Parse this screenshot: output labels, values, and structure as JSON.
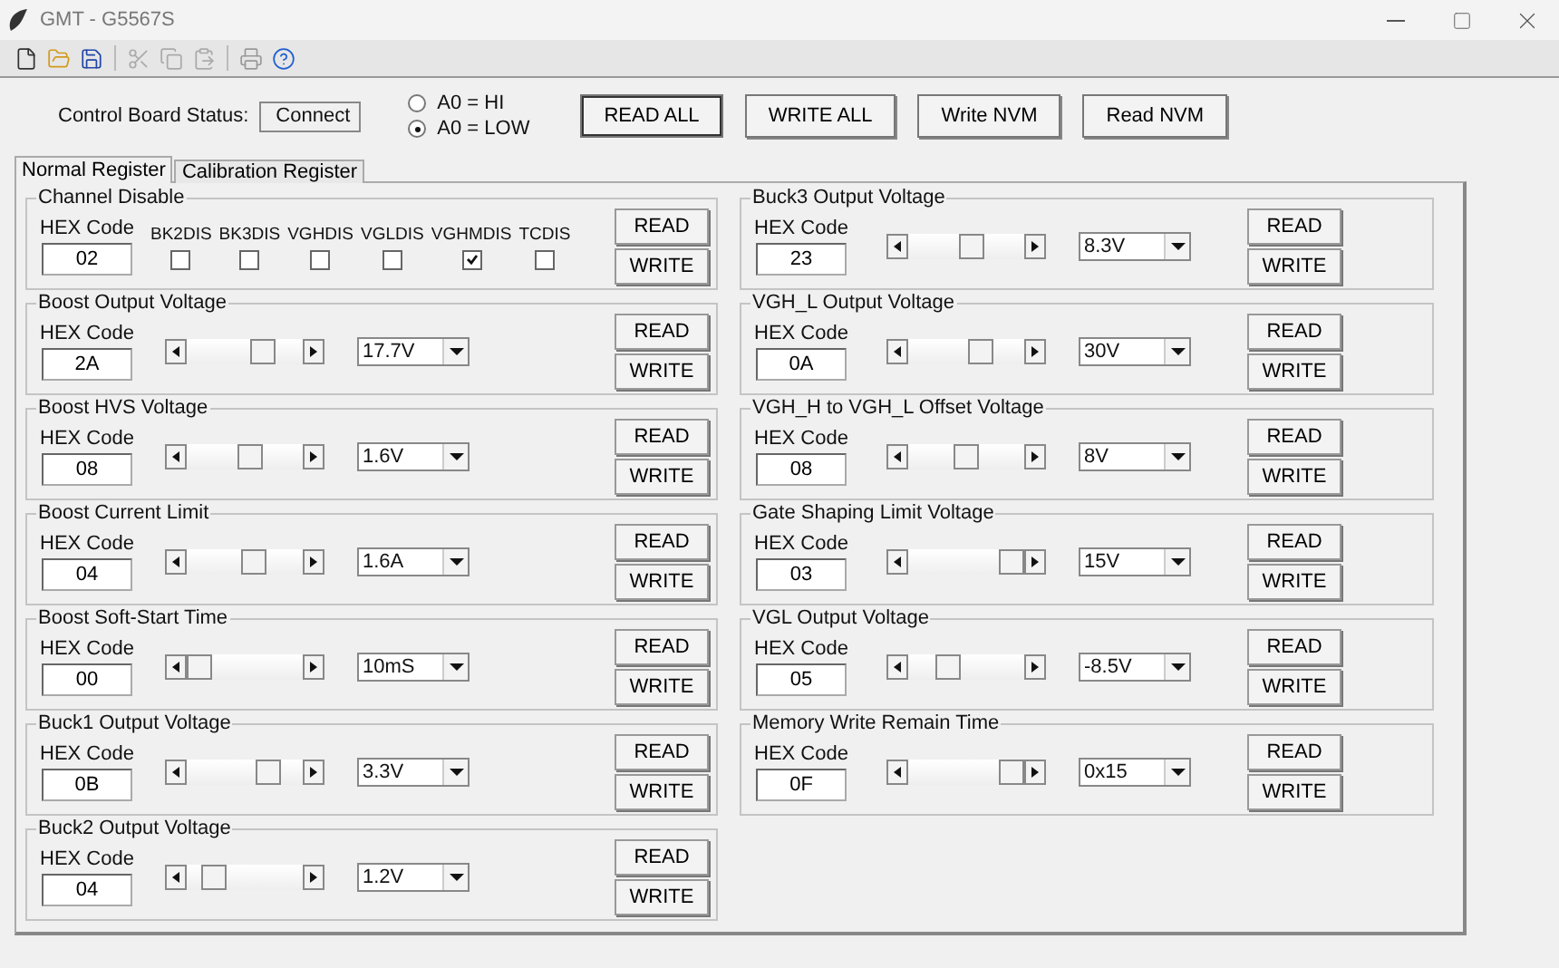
{
  "window": {
    "title": "GMT - G5567S"
  },
  "status": {
    "label": "Control Board Status:",
    "value": "Connect"
  },
  "address": [
    {
      "label": "A0 = HI",
      "selected": false
    },
    {
      "label": "A0 = LOW",
      "selected": true
    }
  ],
  "actions": [
    "READ ALL",
    "WRITE ALL",
    "Write NVM",
    "Read NVM"
  ],
  "tabs": [
    {
      "label": "Normal Register",
      "selected": true
    },
    {
      "label": "Calibration Register",
      "selected": false
    }
  ],
  "left_groups": [
    {
      "kind": "checkboxes",
      "title": "Channel Disable",
      "hex_label": "HEX Code",
      "hex": "02",
      "flags": [
        {
          "label": "BK2DIS",
          "checked": false
        },
        {
          "label": "BK3DIS",
          "checked": false
        },
        {
          "label": "VGHDIS",
          "checked": false
        },
        {
          "label": "VGLDIS",
          "checked": false
        },
        {
          "label": "VGHMDIS",
          "checked": true
        },
        {
          "label": "TCDIS",
          "checked": false
        }
      ],
      "read": "READ",
      "write": "WRITE"
    },
    {
      "kind": "slider",
      "title": "Boost Output Voltage",
      "hex_label": "HEX Code",
      "hex": "2A",
      "level": 0.7,
      "value": "17.7V",
      "read": "READ",
      "write": "WRITE"
    },
    {
      "kind": "slider",
      "title": "Boost HVS Voltage",
      "hex_label": "HEX Code",
      "hex": "08",
      "level": 0.55,
      "value": "1.6V",
      "read": "READ",
      "write": "WRITE"
    },
    {
      "kind": "slider",
      "title": "Boost Current Limit",
      "hex_label": "HEX Code",
      "hex": "04",
      "level": 0.6,
      "value": "1.6A",
      "read": "READ",
      "write": "WRITE"
    },
    {
      "kind": "slider",
      "title": "Boost Soft-Start Time",
      "hex_label": "HEX Code",
      "hex": "00",
      "level": 0,
      "value": "10mS",
      "read": "READ",
      "write": "WRITE"
    },
    {
      "kind": "slider",
      "title": "Buck1 Output Voltage",
      "hex_label": "HEX Code",
      "hex": "0B",
      "level": 0.75,
      "value": "3.3V",
      "read": "READ",
      "write": "WRITE"
    },
    {
      "kind": "slider",
      "title": "Buck2 Output Voltage",
      "hex_label": "HEX Code",
      "hex": "04",
      "level": 0.15,
      "value": "1.2V",
      "read": "READ",
      "write": "WRITE"
    }
  ],
  "right_groups": [
    {
      "kind": "slider",
      "title": "Buck3 Output Voltage",
      "hex_label": "HEX Code",
      "hex": "23",
      "level": 0.55,
      "value": "8.3V",
      "read": "READ",
      "write": "WRITE"
    },
    {
      "kind": "slider",
      "title": "VGH_L Output Voltage",
      "hex_label": "HEX Code",
      "hex": "0A",
      "level": 0.65,
      "value": "30V",
      "read": "READ",
      "write": "WRITE"
    },
    {
      "kind": "slider",
      "title": "VGH_H to VGH_L Offset Voltage",
      "hex_label": "HEX Code",
      "hex": "08",
      "level": 0.5,
      "value": "8V",
      "read": "READ",
      "write": "WRITE"
    },
    {
      "kind": "slider",
      "title": "Gate Shaping Limit Voltage",
      "hex_label": "HEX Code",
      "hex": "03",
      "level": 1,
      "value": "15V",
      "read": "READ",
      "write": "WRITE"
    },
    {
      "kind": "slider",
      "title": "VGL Output Voltage",
      "hex_label": "HEX Code",
      "hex": "05",
      "level": 0.3,
      "value": "-8.5V",
      "read": "READ",
      "write": "WRITE"
    },
    {
      "kind": "slider",
      "title": "Memory Write Remain Time",
      "hex_label": "HEX Code",
      "hex": "0F",
      "level": 1,
      "value": "0x15",
      "read": "READ",
      "write": "WRITE"
    }
  ]
}
